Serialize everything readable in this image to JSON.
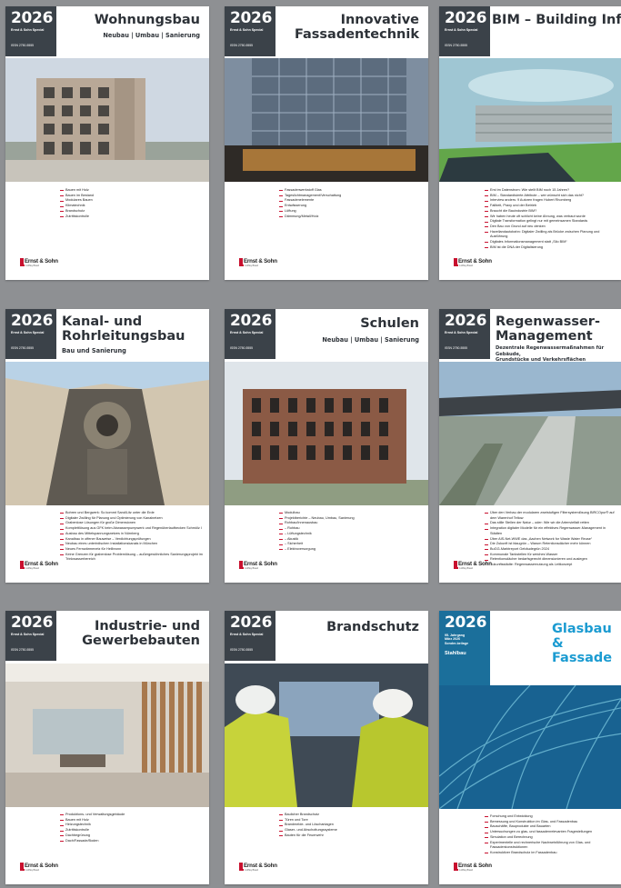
{
  "common": {
    "year": "2026",
    "series": "Ernst & Sohn Special",
    "issn": "ISSN 2750-5555",
    "publisher": "Ernst & Sohn",
    "publisher_sub": "A Wiley Brand"
  },
  "covers": [
    {
      "title": "Wohnungsbau",
      "subtitle": "Neubau | Umbau | Sanierung",
      "bullets": [
        "Bauen mit Holz",
        "Bauen im Bestand",
        "Modulares Bauen",
        "Klimatechnik",
        "Brandschutz",
        "Zutrittskontrolle"
      ]
    },
    {
      "title": "Innovative\nFassadentechnik",
      "subtitle": "",
      "bullets": [
        "Fassadenwerkstoff Glas",
        "Tageslichtmanagement/Verschattung",
        "Fassadenelemente",
        "Entwässerung",
        "Lüftung",
        "Dämmung/Metall/Holz"
      ]
    },
    {
      "title": "BIM – Building\nInformation Modeling",
      "subtitle": "",
      "bullets": [
        "Erst im Datenstrom: Wie stellt BIM noch 15 Jahren?",
        "BIM – Standardisierte Attribute – wer wünscht sich das nicht?",
        "Interview anders: 9 Autoren fragen Hubert Rhomberg",
        "Fallbeit, Praxy und der Betrieb",
        "Braucht die Bauindustrie BIM?",
        "Wir haben heute oft schlicht keine Ahnung, was verbaut wurde",
        "Digitale Transformation gelingt nur mit gemeinsamen Standards",
        "Den Bau von Grund auf neu denken",
        "Havellandautobahn: Digitaler Zwilling als Brücke zwischen Planung und Ausführung",
        "Digitales Informationsmanagement statt „Silo BIM“",
        "BIM ist die DNA der Digitalisierung"
      ]
    },
    {
      "title": "Kanal- und\nRohrleitungsbau",
      "subtitle": "Bau und Sanierung",
      "bullets": [
        "Bohren und Bergwerk: So kommt Sand/Litz unter die Erde",
        "Digitaler Zwilling für Planung und Optimierung von Kanalnetzen",
        "Grabenlose Lösungen für große Dimensionen",
        "Komplettlösung aus GFK beim Abwasserpumpwerk und Regenüberlaufbecken Schmölz I",
        "Ausbau des Mittelspannungsnetzes in Nürnberg",
        "Kanalbau in offener Bauweise – Verdichtungsprüfungen",
        "Neubau eines unterirdischen Installationskanals in München",
        "Neues Fernwärmenetz für Heilbronn",
        "Keine Grenzen für grabenlose Problemlösung – außergewöhnliches Sanierungsprojekt im Trinkwasserbereich"
      ]
    },
    {
      "title": "Schulen",
      "subtitle": "Neubau | Umbau | Sanierung",
      "bullets": [
        "Modulbau",
        "Projektberichte – Neubau, Umbau, Sanierung",
        "Rohbau/Innenausbau",
        "– Rohbau",
        "– Lüftungstechnik",
        "– Akustik",
        "– Sicherheit",
        "– Elektroversorgung"
      ]
    },
    {
      "title": "Regenwasser-\nManagement",
      "subtitle": "Dezentrale Regenwassermaßnahmen für Gebäude,\nGrundstücke und Verkehrsflächen",
      "bullets": [
        "Über den Verbau der modularen zweistufigen Filtersystemlösung BIRCOpur® auf dem Warenhof Teltow",
        "Das stille Stellen der Natur – oder: Wie wir die Artenvielfalt retten",
        "Integration digitaler Modelle für ein effektives Regenwasser-Management in Städten",
        "Über AIS-Net-WWE das „Aachen Network for Waste Water Reuse“",
        "Die Zukunft ist blaugrün – Warum Retentionsdächer mehr können",
        "BuGG-Marktreport Gebäudegrün 2024",
        "Kommunale Tankstellen für weiches Wasser",
        "Retentionsdächer bedarfsgerecht dimensionieren und auslegen",
        "Zukunftsstädte: Regenwassernutzung als Leitkonzept"
      ]
    },
    {
      "title": "Industrie- und\nGewerbebauten",
      "subtitle": "",
      "bullets": [
        "Produktions- und Verwaltungsgebäude",
        "Bauen mit Holz",
        "Heizungstechnik",
        "Zutrittskontrolle",
        "Dachbegrünung",
        "Dach/Fassade/Boden"
      ]
    },
    {
      "title": "Brandschutz",
      "subtitle": "",
      "bullets": [
        "Baulicher Brandschutz",
        "Türen und Tore",
        "Brandmelde- und Löschanlagen",
        "Glaser- und Abschottungssysteme",
        "Bauten für die Feuerwehr"
      ]
    },
    {
      "title": "Glasbau &\nFassade",
      "subtitle": "",
      "series": "95. Jahrgang\nMärz 2026\nSonder-beilage",
      "tagline": "Stahlbau",
      "bullets": [
        "Forschung und Entwicklung",
        "Bemessung und Konstruktion im Glas- und Fassadenbau",
        "Bauschäfte, Bauprodukte und Bauarten",
        "Untersuchungen zu glas- und fassadenrelevanten Fragestellungen",
        "Simulation und Berechnung",
        "Experimentelle und rechnerische Nachweisführung von Glas- und Fassadenkonstruktionen",
        "Konstruktiver Brandschutz im Fassadenbau"
      ]
    }
  ],
  "colors": {
    "background": "#8e9093",
    "year_box": "#3b4249",
    "accent_red": "#c8102e",
    "glasbau_blue": "#1b6f9b",
    "title": "#2d3238"
  }
}
